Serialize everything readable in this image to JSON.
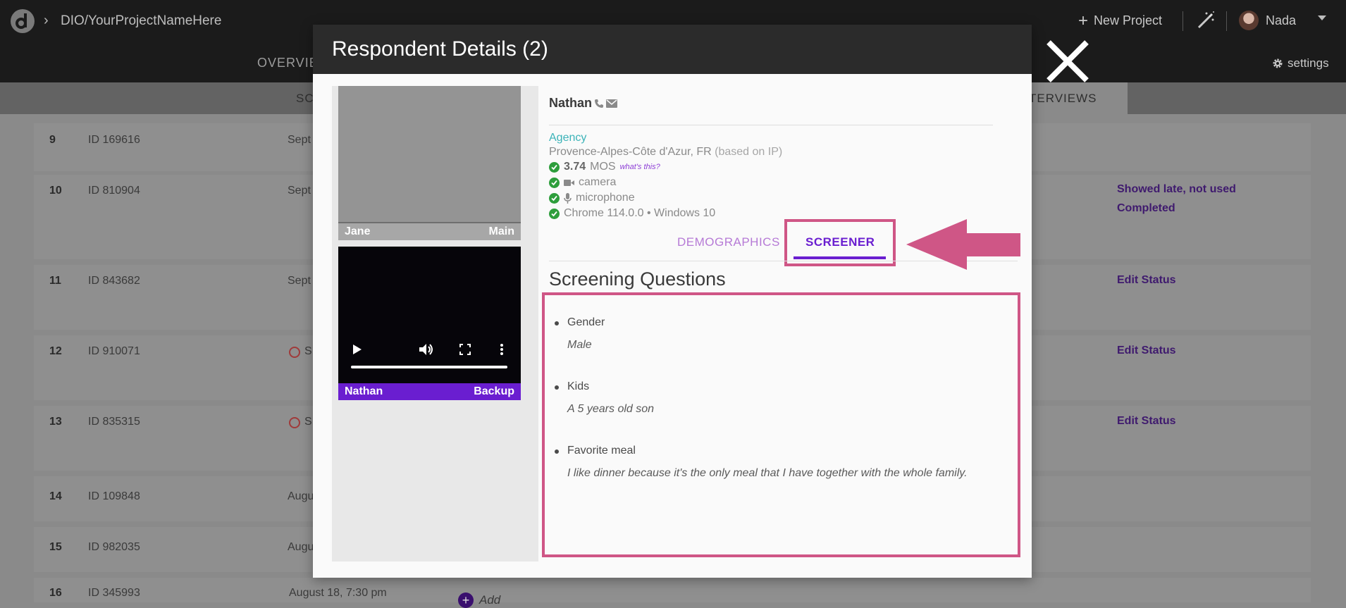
{
  "topbar": {
    "breadcrumb": "DIO/YourProjectNameHere",
    "new_project_label": "New Project",
    "user_name": "Nada",
    "settings_label": "settings"
  },
  "nav": {
    "overview_partial": "OVERVIE",
    "tab_sc_partial": "SC",
    "tab_interviews_partial": "TERVIEWS"
  },
  "rows": [
    {
      "num": "9",
      "id": "ID 169616",
      "date": "Sept",
      "status": ""
    },
    {
      "num": "10",
      "id": "ID 810904",
      "date": "Sept",
      "status": "Showed late, not used",
      "status2": "Completed"
    },
    {
      "num": "11",
      "id": "ID 843682",
      "date": "Sept",
      "status": "Edit Status"
    },
    {
      "num": "12",
      "id": "ID 910071",
      "date": "S",
      "status": "Edit Status"
    },
    {
      "num": "13",
      "id": "ID 835315",
      "date": "S",
      "status": "Edit Status"
    },
    {
      "num": "14",
      "id": "ID 109848",
      "date": "Augu",
      "status": ""
    },
    {
      "num": "15",
      "id": "ID 982035",
      "date": "Augu",
      "status": ""
    },
    {
      "num": "16",
      "id": "ID 345993",
      "date": "August 18, 7:30 pm",
      "status": ""
    }
  ],
  "add_label": "Add",
  "modal": {
    "title": "Respondent Details (2)",
    "tile_main": {
      "name": "Jane",
      "role": "Main"
    },
    "tile_backup": {
      "name": "Nathan",
      "role": "Backup"
    },
    "respondent_name": "Nathan",
    "agency": "Agency",
    "location": "Provence-Alpes-Côte d'Azur, FR",
    "location_note": "(based on IP)",
    "mos_value": "3.74",
    "mos_label": "MOS",
    "whats_this": "what's this?",
    "camera": "camera",
    "microphone": "microphone",
    "browser": "Chrome 114.0.0 • Windows 10",
    "tabs": {
      "demographics": "DEMOGRAPHICS",
      "screener": "SCREENER"
    },
    "screening_title": "Screening Questions",
    "questions": [
      {
        "q": "Gender",
        "a": "Male"
      },
      {
        "q": "Kids",
        "a": "A 5 years old son"
      },
      {
        "q": "Favorite meal",
        "a": "I like dinner because it's the only meal that I have together with the whole family."
      }
    ]
  },
  "colors": {
    "accent": "#6a1ed0",
    "highlight": "#cf5686",
    "agency": "#3bb3b8",
    "check": "#2e9e3c"
  },
  "icons": [
    "logo-icon",
    "chevron-right-icon",
    "plus-icon",
    "magic-wand-icon",
    "caret-down-icon",
    "gear-icon",
    "phone-icon",
    "mail-icon",
    "check-icon",
    "camera-icon",
    "microphone-icon",
    "play-icon",
    "volume-icon",
    "fullscreen-icon",
    "more-vert-icon",
    "close-icon",
    "arrow-left-icon",
    "clock-icon"
  ]
}
